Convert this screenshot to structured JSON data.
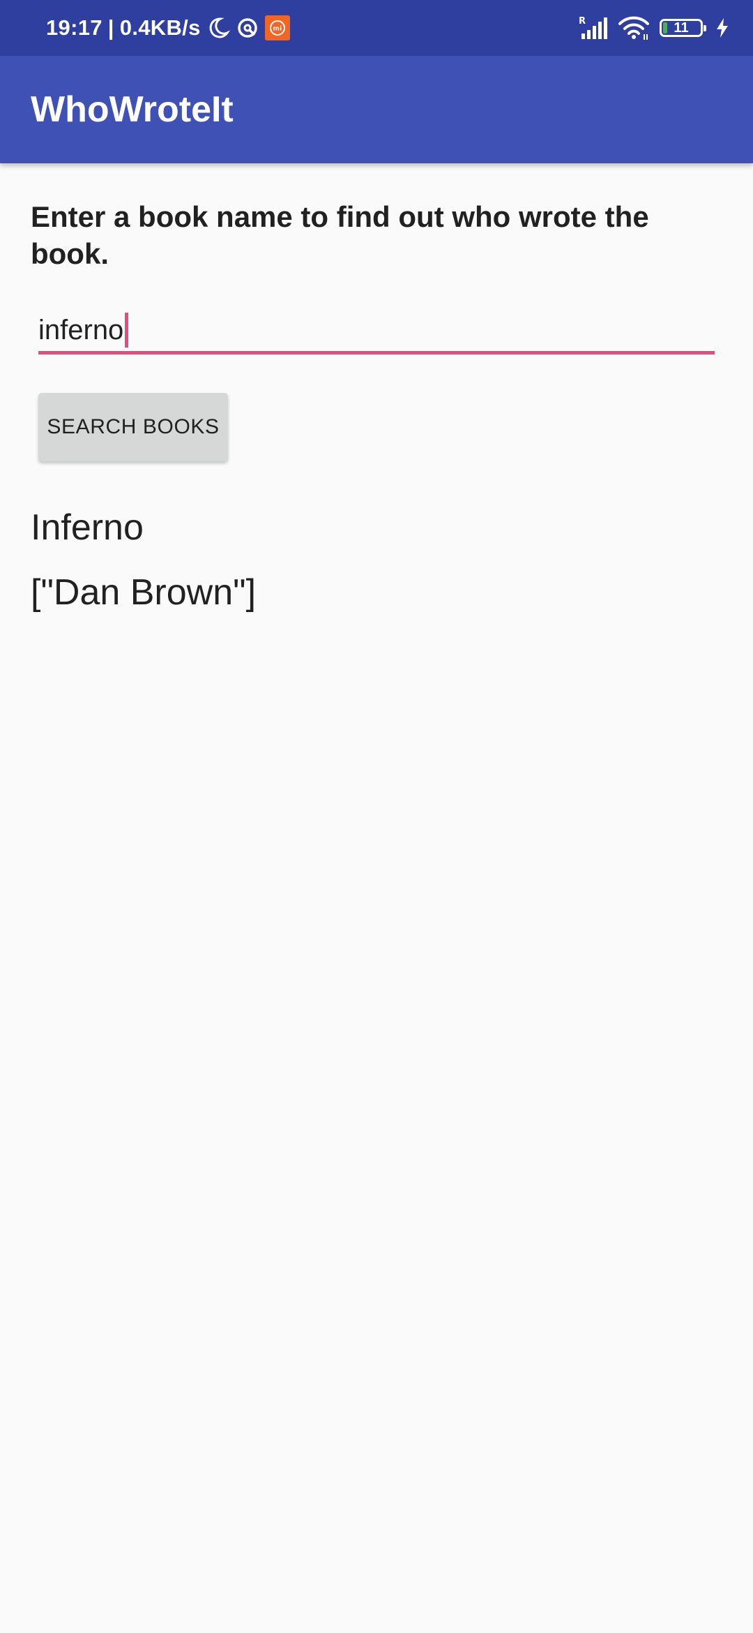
{
  "status_bar": {
    "time": "19:17",
    "separator": "|",
    "network_speed": "0.4KB/s",
    "icons": [
      "moon-icon",
      "data-saver-icon",
      "mi-app-icon",
      "signal-icon",
      "wifi-icon",
      "charging-icon"
    ],
    "signal_badge": "R",
    "battery_level": "11",
    "battery_fraction": 0.11,
    "background_color": "#2f3f9f"
  },
  "app_bar": {
    "title": "WhoWroteIt",
    "background_color": "#3f51b5"
  },
  "main": {
    "prompt": "Enter a book name to find out who wrote the book.",
    "search_input": {
      "value": "inferno",
      "accent_color": "#e84a7f"
    },
    "search_button_label": "SEARCH BOOKS",
    "result_title": "Inferno",
    "result_author": "[\"Dan Brown\"]"
  }
}
